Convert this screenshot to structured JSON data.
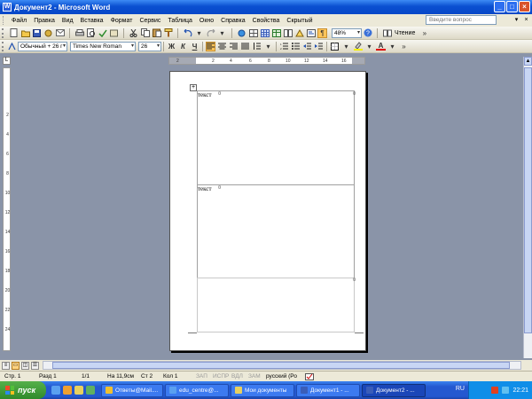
{
  "window": {
    "title": "Документ2 - Microsoft Word",
    "app_icon": "W",
    "min_icon": "_",
    "max_icon": "□",
    "close_icon": "×"
  },
  "menu": {
    "items": [
      "Файл",
      "Правка",
      "Вид",
      "Вставка",
      "Формат",
      "Сервис",
      "Таблица",
      "Окно",
      "Справка",
      "Свойства",
      "Скрытый"
    ],
    "ask_placeholder": "Введите вопрос",
    "ask_dropdown": "▾",
    "doc_close": "×"
  },
  "standard_toolbar": {
    "zoom": "48%",
    "reading_label": "Чтение"
  },
  "format_toolbar": {
    "style": "Обычный + 26 г",
    "font": "Times New Roman",
    "size": "26",
    "bold": "Ж",
    "italic": "К",
    "underline": "Ч",
    "font_color_glyph": "A"
  },
  "rulers": {
    "corner_glyph": "L",
    "h_ticks": [
      "2",
      "2",
      "4",
      "6",
      "8",
      "10",
      "12",
      "14",
      "16"
    ],
    "v_ticks": [
      "2",
      "4",
      "6",
      "8",
      "10",
      "12",
      "14",
      "16",
      "18",
      "20",
      "22",
      "24"
    ]
  },
  "document": {
    "cell1_text": "текст",
    "cell2_text": "текст",
    "table_move_glyph": "+",
    "cell_mark_glyph": "¤"
  },
  "statusbar": {
    "page": "Стр. 1",
    "section": "Разд 1",
    "pages": "1/1",
    "at": "На 11,9см",
    "line": "Ст 2",
    "col": "Кол 1",
    "rec": "ЗАП",
    "trk": "ИСПР",
    "ext": "ВДЛ",
    "ovr": "ЗАМ",
    "language": "русский (Ро"
  },
  "taskbar": {
    "start": "пуск",
    "tasks": [
      "Ответы@Mail....",
      "edu_centre@...",
      "Мои документы",
      "Документ1 - ...",
      "Документ2 - ..."
    ],
    "lang": "RU",
    "time": "22:21"
  },
  "colors": {
    "titlebar": "#0a4fd1",
    "workspace": "#8a94a8",
    "taskbar": "#2458d0",
    "start": "#2f8a2a"
  }
}
